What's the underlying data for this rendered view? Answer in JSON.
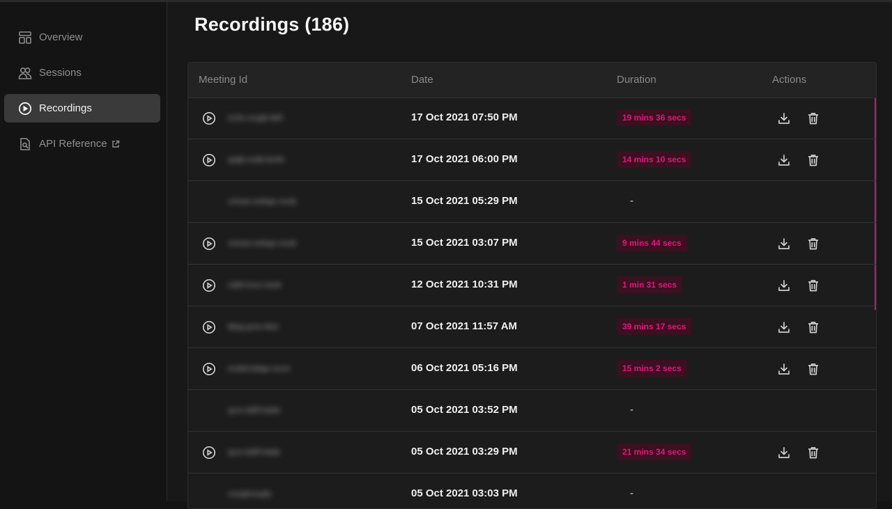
{
  "sidebar": {
    "items": [
      {
        "label": "Overview",
        "icon": "layout-icon"
      },
      {
        "label": "Sessions",
        "icon": "users-icon"
      },
      {
        "label": "Recordings",
        "icon": "play-circle-icon",
        "active": true
      },
      {
        "label": "API Reference",
        "icon": "document-search-icon"
      }
    ]
  },
  "main": {
    "title": "Recordings (186)",
    "columns": [
      "Meeting Id",
      "Date",
      "Duration",
      "Actions"
    ],
    "rows": [
      {
        "meeting_id": "icvfu-ocyjb-kkfi",
        "date": "17 Oct 2021 07:50 PM",
        "duration": "19 mins 36 secs",
        "has_recording": true
      },
      {
        "meeting_id": "qsljb-esfd-kmfn",
        "date": "17 Oct 2021 06:00 PM",
        "duration": "14 mins 10 secs",
        "has_recording": true
      },
      {
        "meeting_id": "vnooe-evkqe-vvub",
        "date": "15 Oct 2021 05:29 PM",
        "duration": "-",
        "has_recording": false
      },
      {
        "meeting_id": "vnooe-evkqe-vvub",
        "date": "15 Oct 2021 03:07 PM",
        "duration": "9 mins 44 secs",
        "has_recording": true
      },
      {
        "meeting_id": "cdbf-lsvo-vesk",
        "date": "12 Oct 2021 10:31 PM",
        "duration": "1 min 31 secs",
        "has_recording": true
      },
      {
        "meeting_id": "tkbq-pvro-tksi",
        "date": "07 Oct 2021 11:57 AM",
        "duration": "39 mins 17 secs",
        "has_recording": true
      },
      {
        "meeting_id": "mvbd-bdqe-ncce",
        "date": "06 Oct 2021 05:16 PM",
        "duration": "15 mins 2 secs",
        "has_recording": true
      },
      {
        "meeting_id": "qcvr-bkff-hdsk",
        "date": "05 Oct 2021 03:52 PM",
        "duration": "-",
        "has_recording": false
      },
      {
        "meeting_id": "qcvr-bkff-hdsk",
        "date": "05 Oct 2021 03:29 PM",
        "duration": "21 mins 34 secs",
        "has_recording": true
      },
      {
        "meeting_id": "vvsqlnvsqfu",
        "date": "05 Oct 2021 03:03 PM",
        "duration": "-",
        "has_recording": false
      }
    ]
  },
  "colors": {
    "accent": "#e0177d",
    "badge_bg": "#3b1020",
    "background": "#181818",
    "active_nav": "#3a3a3a"
  }
}
